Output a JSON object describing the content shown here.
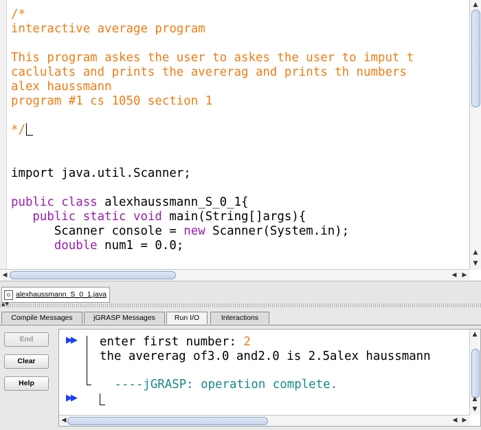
{
  "editor": {
    "lines": [
      {
        "cls": "cm",
        "text": "/*"
      },
      {
        "cls": "cm",
        "text": "interactive average program"
      },
      {
        "cls": "",
        "text": ""
      },
      {
        "cls": "cm",
        "text": "This program askes the user to askes the user to imput t"
      },
      {
        "cls": "cm",
        "text": "caclulats and prints the avererag and prints th numbers"
      },
      {
        "cls": "cm",
        "text": "alex haussmann"
      },
      {
        "cls": "cm",
        "text": "program #1 cs 1050 section 1"
      },
      {
        "cls": "",
        "text": ""
      },
      {
        "cls": "cm",
        "text": "*/",
        "cursor": true
      },
      {
        "cls": "",
        "text": ""
      },
      {
        "cls": "",
        "text": ""
      },
      {
        "cls": "",
        "text": "import java.util.Scanner;"
      },
      {
        "cls": "",
        "text": ""
      },
      {
        "segments": [
          {
            "cls": "kw",
            "text": "public class"
          },
          {
            "cls": "",
            "text": " alexhaussmann_S_0_1{"
          }
        ]
      },
      {
        "segments": [
          {
            "cls": "",
            "text": "   "
          },
          {
            "cls": "kw",
            "text": "public static void"
          },
          {
            "cls": "",
            "text": " main(String[]args){"
          }
        ]
      },
      {
        "segments": [
          {
            "cls": "",
            "text": "      Scanner console = "
          },
          {
            "cls": "kw",
            "text": "new"
          },
          {
            "cls": "",
            "text": " Scanner(System.in);"
          }
        ]
      },
      {
        "segments": [
          {
            "cls": "",
            "text": "      "
          },
          {
            "cls": "kw",
            "text": "double"
          },
          {
            "cls": "",
            "text": " num1 = 0.0;"
          }
        ]
      }
    ]
  },
  "file_tab": {
    "label": "alexhaussmann_S_0_1.java",
    "icon_text": "G"
  },
  "message_tabs": {
    "compile": "Compile Messages",
    "jgrasp": "jGRASP Messages",
    "run_io": "Run I/O",
    "interactions": "Interactions",
    "active": "Run I/O"
  },
  "buttons": {
    "end": "End",
    "clear": "Clear",
    "help": "Help"
  },
  "console": {
    "prompt_symbol": "▶▶",
    "line1_prefix": "enter first number: ",
    "line1_input": "2",
    "line2": "the avererag of3.0 and2.0 is 2.5alex haussmann",
    "status": " ----jGRASP: operation complete."
  },
  "colors": {
    "comment": "#f07d14",
    "keyword": "#9b1eb0",
    "status": "#158a8a",
    "prompt": "#1a3cff"
  }
}
